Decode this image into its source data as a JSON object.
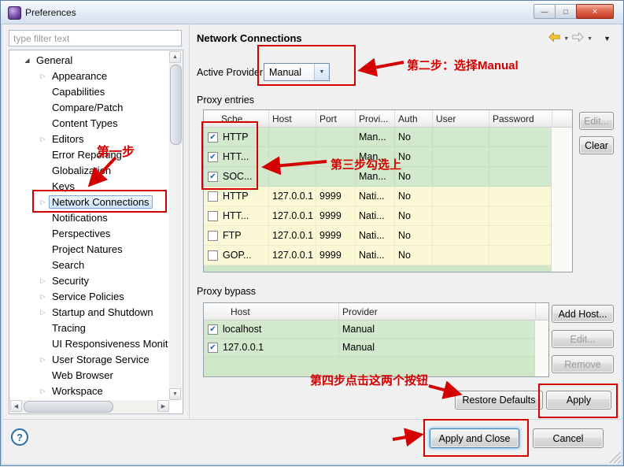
{
  "titlebar": {
    "title": "Preferences",
    "minimize_glyph": "—",
    "maximize_glyph": "□",
    "close_glyph": "×"
  },
  "sidebar": {
    "filter_placeholder": "type filter text",
    "tree": [
      {
        "label": "General",
        "level": 0,
        "arrow": "expanded",
        "selected": false
      },
      {
        "label": "Appearance",
        "level": 1,
        "arrow": "collapsed",
        "selected": false
      },
      {
        "label": "Capabilities",
        "level": 1,
        "arrow": "none",
        "selected": false
      },
      {
        "label": "Compare/Patch",
        "level": 1,
        "arrow": "none",
        "selected": false
      },
      {
        "label": "Content Types",
        "level": 1,
        "arrow": "none",
        "selected": false
      },
      {
        "label": "Editors",
        "level": 1,
        "arrow": "collapsed",
        "selected": false
      },
      {
        "label": "Error Reporting",
        "level": 1,
        "arrow": "none",
        "selected": false
      },
      {
        "label": "Globalization",
        "level": 1,
        "arrow": "none",
        "selected": false
      },
      {
        "label": "Keys",
        "level": 1,
        "arrow": "none",
        "selected": false
      },
      {
        "label": "Network Connections",
        "level": 1,
        "arrow": "collapsed",
        "selected": true
      },
      {
        "label": "Notifications",
        "level": 1,
        "arrow": "none",
        "selected": false
      },
      {
        "label": "Perspectives",
        "level": 1,
        "arrow": "none",
        "selected": false
      },
      {
        "label": "Project Natures",
        "level": 1,
        "arrow": "none",
        "selected": false
      },
      {
        "label": "Search",
        "level": 1,
        "arrow": "none",
        "selected": false
      },
      {
        "label": "Security",
        "level": 1,
        "arrow": "collapsed",
        "selected": false
      },
      {
        "label": "Service Policies",
        "level": 1,
        "arrow": "collapsed",
        "selected": false
      },
      {
        "label": "Startup and Shutdown",
        "level": 1,
        "arrow": "collapsed",
        "selected": false
      },
      {
        "label": "Tracing",
        "level": 1,
        "arrow": "none",
        "selected": false
      },
      {
        "label": "UI Responsiveness Monit",
        "level": 1,
        "arrow": "none",
        "selected": false
      },
      {
        "label": "User Storage Service",
        "level": 1,
        "arrow": "collapsed",
        "selected": false
      },
      {
        "label": "Web Browser",
        "level": 1,
        "arrow": "none",
        "selected": false
      },
      {
        "label": "Workspace",
        "level": 1,
        "arrow": "collapsed",
        "selected": false
      }
    ]
  },
  "page": {
    "title": "Network Connections",
    "active_provider": {
      "label": "Active Provider:",
      "value": "Manual"
    },
    "proxy_entries": {
      "label": "Proxy entries",
      "columns": [
        "Sche...",
        "Host",
        "Port",
        "Provi...",
        "Auth",
        "User",
        "Password"
      ],
      "rows": [
        {
          "checked": true,
          "cells": [
            "HTTP",
            "",
            "",
            "Man...",
            "No",
            "",
            ""
          ]
        },
        {
          "checked": true,
          "cells": [
            "HTT...",
            "",
            "",
            "Man...",
            "No",
            "",
            ""
          ]
        },
        {
          "checked": true,
          "cells": [
            "SOC...",
            "",
            "",
            "Man...",
            "No",
            "",
            ""
          ]
        },
        {
          "checked": false,
          "cells": [
            "HTTP",
            "127.0.0.1",
            "9999",
            "Nati...",
            "No",
            "",
            ""
          ]
        },
        {
          "checked": false,
          "cells": [
            "HTT...",
            "127.0.0.1",
            "9999",
            "Nati...",
            "No",
            "",
            ""
          ]
        },
        {
          "checked": false,
          "cells": [
            "FTP",
            "127.0.0.1",
            "9999",
            "Nati...",
            "No",
            "",
            ""
          ]
        },
        {
          "checked": false,
          "cells": [
            "GOP...",
            "127.0.0.1",
            "9999",
            "Nati...",
            "No",
            "",
            ""
          ]
        }
      ],
      "buttons": [
        {
          "label": "Edit...",
          "disabled": true
        },
        {
          "label": "Clear",
          "disabled": false
        }
      ]
    },
    "proxy_bypass": {
      "label": "Proxy bypass",
      "columns": [
        "Host",
        "Provider"
      ],
      "rows": [
        {
          "checked": true,
          "cells": [
            "localhost",
            "Manual"
          ]
        },
        {
          "checked": true,
          "cells": [
            "127.0.0.1",
            "Manual"
          ]
        }
      ],
      "buttons": [
        {
          "label": "Add Host...",
          "disabled": false
        },
        {
          "label": "Edit...",
          "disabled": true
        },
        {
          "label": "Remove",
          "disabled": true
        }
      ]
    },
    "restore_defaults": "Restore Defaults",
    "apply": "Apply"
  },
  "footer": {
    "help": "?",
    "apply_and_close": "Apply and Close",
    "cancel": "Cancel"
  },
  "annotations": {
    "step1": "第一步",
    "step2": "第二步：选择Manual",
    "step3": "第三步勾选上",
    "step4": "第四步点击这两个按钮",
    "color": "#d40000"
  },
  "colors": {
    "row_checked": "#d3e9cd",
    "row_unchecked": "#fbf8d6",
    "table_empty": "#cfe7c6"
  }
}
